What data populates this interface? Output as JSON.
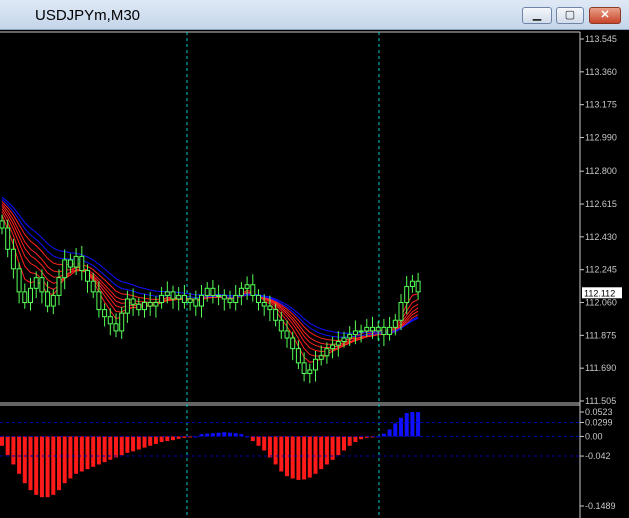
{
  "window": {
    "title": "USDJPYm,M30",
    "minimize_glyph": "▁",
    "maximize_glyph": "▢",
    "close_glyph": "✕"
  },
  "colors": {
    "background": "#000000",
    "axis": "#c8c8c8",
    "grid": "#00c8c8",
    "bull_candle": "#55ff55",
    "ribbon": "#ff2020",
    "histogram_negative": "#ff1a1a",
    "histogram_positive": "#1010ff",
    "price_label_bg": "#ffffff",
    "zero_line": "#0000aa"
  },
  "price_axis": {
    "ticks": [
      "113.545",
      "113.360",
      "113.175",
      "112.990",
      "112.800",
      "112.615",
      "112.430",
      "112.245",
      "112.060",
      "111.875",
      "111.690",
      "111.505"
    ],
    "current_price": "112.112"
  },
  "indicator_axis": {
    "ticks": [
      "0.0523",
      "0.0299",
      "0.00",
      "-0.042",
      "-0.1489"
    ]
  },
  "chart_data": {
    "type": "candlestick",
    "symbol": "USDJPYm",
    "timeframe": "M30",
    "price_range": [
      111.505,
      113.545
    ],
    "closes": [
      112.48,
      112.36,
      112.25,
      112.12,
      112.06,
      112.14,
      112.2,
      112.12,
      112.04,
      112.1,
      112.2,
      112.3,
      112.26,
      112.32,
      112.24,
      112.18,
      112.12,
      112.02,
      111.98,
      111.94,
      111.9,
      112.0,
      112.08,
      112.05,
      112.02,
      112.06,
      112.04,
      112.06,
      112.1,
      112.12,
      112.08,
      112.1,
      112.06,
      112.08,
      112.04,
      112.1,
      112.14,
      112.1,
      112.1,
      112.08,
      112.06,
      112.1,
      112.14,
      112.16,
      112.1,
      112.06,
      112.04,
      112.02,
      111.96,
      111.9,
      111.86,
      111.8,
      111.72,
      111.66,
      111.68,
      111.74,
      111.76,
      111.8,
      111.82,
      111.84,
      111.86,
      111.88,
      111.9,
      111.9,
      111.92,
      111.9,
      111.92,
      111.88,
      111.92,
      111.96,
      112.06,
      112.15,
      112.18,
      112.12
    ],
    "histogram_range": [
      -0.1489,
      0.0523
    ],
    "histogram": [
      -0.02,
      -0.04,
      -0.06,
      -0.08,
      -0.1,
      -0.115,
      -0.125,
      -0.13,
      -0.13,
      -0.125,
      -0.115,
      -0.1,
      -0.09,
      -0.08,
      -0.075,
      -0.07,
      -0.065,
      -0.06,
      -0.055,
      -0.05,
      -0.045,
      -0.04,
      -0.035,
      -0.032,
      -0.028,
      -0.024,
      -0.02,
      -0.016,
      -0.012,
      -0.01,
      -0.008,
      -0.005,
      -0.003,
      -0.002,
      0.0,
      0.005,
      0.006,
      0.007,
      0.008,
      0.009,
      0.008,
      0.007,
      0.005,
      0.0,
      -0.01,
      -0.02,
      -0.03,
      -0.045,
      -0.06,
      -0.075,
      -0.085,
      -0.09,
      -0.093,
      -0.092,
      -0.088,
      -0.08,
      -0.07,
      -0.06,
      -0.05,
      -0.04,
      -0.03,
      -0.02,
      -0.012,
      -0.006,
      -0.003,
      -0.001,
      0.0,
      0.006,
      0.015,
      0.028,
      0.04,
      0.05,
      0.0523,
      0.052
    ]
  }
}
